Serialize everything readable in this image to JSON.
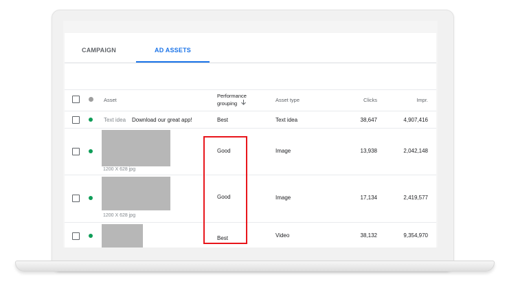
{
  "tabs": [
    {
      "label": "CAMPAIGN",
      "active": false
    },
    {
      "label": "AD ASSETS",
      "active": true
    }
  ],
  "table": {
    "headers": {
      "asset": "Asset",
      "performance_line1": "Performance",
      "performance_line2": "grouping",
      "sort_icon": "arrow-down",
      "asset_type": "Asset type",
      "clicks": "Clicks",
      "impr": "Impr."
    },
    "rows": [
      {
        "asset_label": "Text idea",
        "asset_text": "Download our great app!",
        "status": "enabled",
        "performance": "Best",
        "asset_type": "Text idea",
        "clicks": "38,647",
        "impr": "4,907,416"
      },
      {
        "caption": "1200 X 628 jpg",
        "status": "enabled",
        "performance": "Good",
        "asset_type": "Image",
        "clicks": "13,938",
        "impr": "2,042,148"
      },
      {
        "caption": "1200 X 628 jpg",
        "status": "enabled",
        "performance": "Good",
        "asset_type": "Image",
        "clicks": "17,134",
        "impr": "2,419,577"
      },
      {
        "status": "enabled",
        "performance": "Best",
        "asset_type": "Video",
        "clicks": "38,132",
        "impr": "9,354,970"
      }
    ]
  },
  "colors": {
    "accent": "#1a73e8",
    "status_enabled": "#0f9d58",
    "status_header": "#9e9e9e",
    "highlight": "#e8141a",
    "thumbnail": "#b7b7b7"
  }
}
